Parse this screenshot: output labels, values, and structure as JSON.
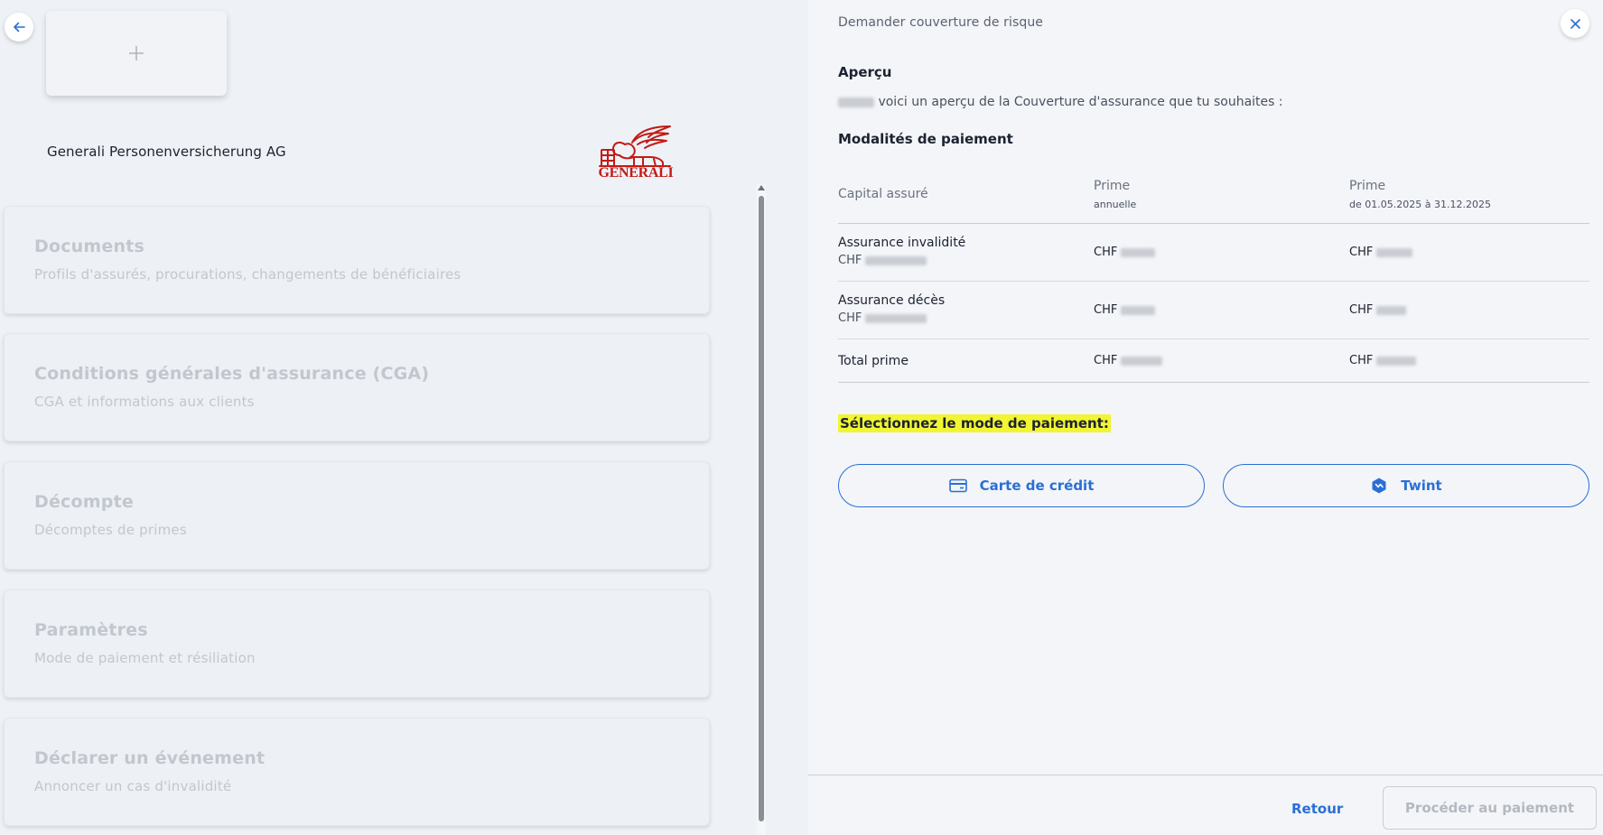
{
  "left": {
    "company_name": "Generali Personenversicherung AG",
    "logo_text": "GENERALI",
    "cards": [
      {
        "title": "Documents",
        "subtitle": "Profils d'assurés, procurations, changements de bénéficiaires"
      },
      {
        "title": "Conditions générales d'assurance (CGA)",
        "subtitle": "CGA et informations aux clients"
      },
      {
        "title": "Décompte",
        "subtitle": "Décomptes de primes"
      },
      {
        "title": "Paramètres",
        "subtitle": "Mode de paiement et résiliation"
      },
      {
        "title": "Déclarer un événement",
        "subtitle": "Annoncer un cas d'invalidité"
      }
    ]
  },
  "panel": {
    "title": "Demander couverture de risque",
    "overview_heading": "Aperçu",
    "intro_text": "voici un aperçu de la Couverture d'assurance que tu souhaites :",
    "payment_terms_heading": "Modalités de paiement",
    "table": {
      "col1": "Capital assuré",
      "col2": "Prime",
      "col2_sub": "annuelle",
      "col3": "Prime",
      "col3_sub": "de 01.05.2025 à 31.12.2025",
      "rows": [
        {
          "label": "Assurance invalidité",
          "sub": "CHF",
          "annual": "CHF",
          "period": "CHF"
        },
        {
          "label": "Assurance décès",
          "sub": "CHF",
          "annual": "CHF",
          "period": "CHF"
        },
        {
          "label": "Total prime",
          "annual": "CHF",
          "period": "CHF"
        }
      ]
    },
    "select_payment": "Sélectionnez le mode de paiement:",
    "pay_options": {
      "card": "Carte de crédit",
      "twint": "Twint"
    },
    "footer": {
      "back": "Retour",
      "proceed": "Procéder au paiement"
    }
  },
  "colors": {
    "accent": "#2a6fd6",
    "highlight": "#f2f532",
    "brand_red": "#c21b17"
  }
}
